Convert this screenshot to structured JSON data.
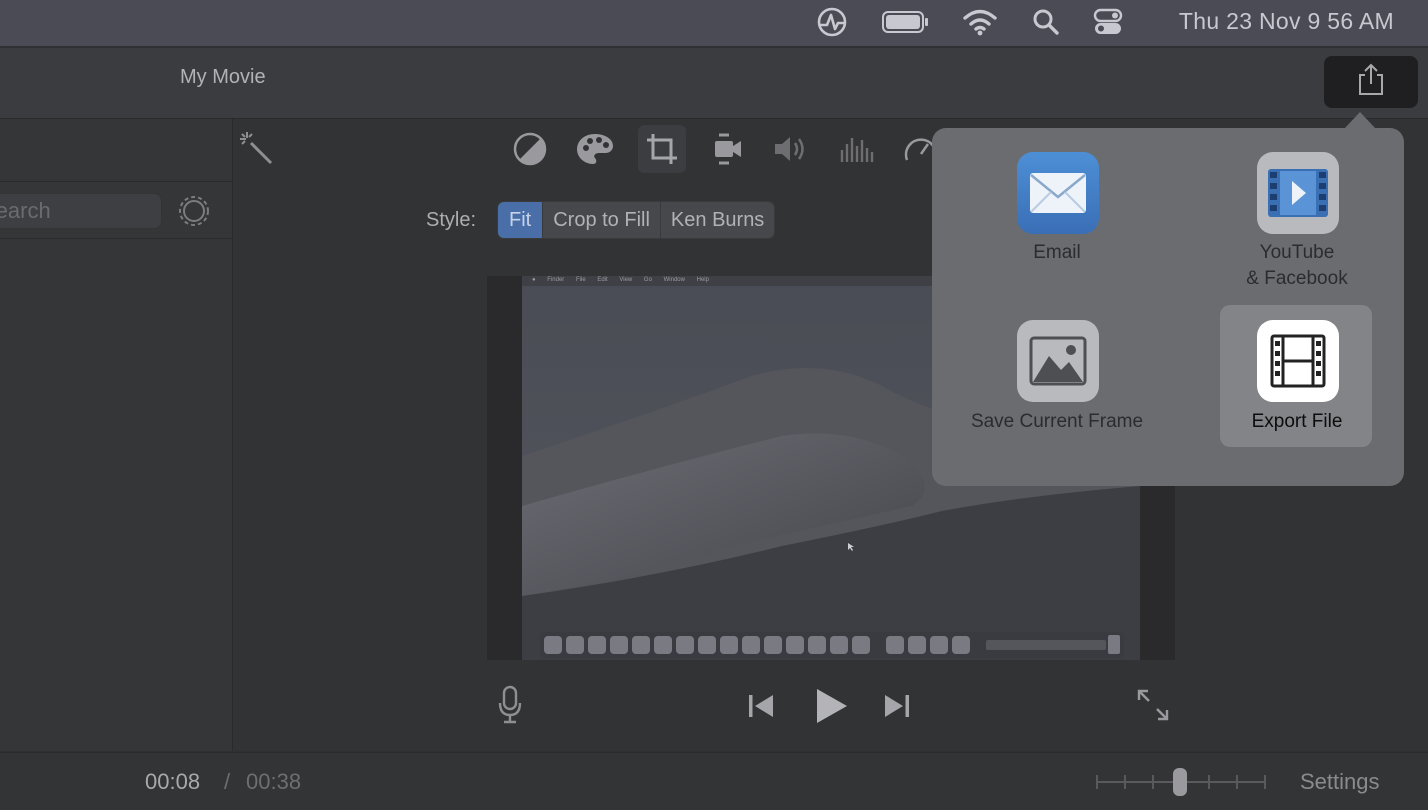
{
  "menubar": {
    "clock": "Thu 23 Nov  9 56 AM",
    "icons": [
      "activity-icon",
      "battery-icon",
      "wifi-icon",
      "search-icon",
      "control-center-icon"
    ]
  },
  "app": {
    "title": "My Movie"
  },
  "sidebar": {
    "search_placeholder": "Search"
  },
  "toolbar": {
    "tools": [
      "magic-wand-icon",
      "color-balance-icon",
      "color-correction-icon",
      "crop-icon",
      "stabilization-icon",
      "volume-icon",
      "equalizer-icon",
      "speed-icon"
    ],
    "active_tool": "crop-icon"
  },
  "style": {
    "label": "Style:",
    "options": [
      "Fit",
      "Crop to Fill",
      "Ken Burns"
    ],
    "selected": "Fit"
  },
  "preview": {
    "menu_items": [
      "Finder",
      "File",
      "Edit",
      "View",
      "Go",
      "Window",
      "Help"
    ]
  },
  "playback": {
    "current": "00:08",
    "separator": "/",
    "total": "00:38"
  },
  "bottom": {
    "settings_label": "Settings"
  },
  "share_menu": {
    "items": [
      {
        "label": "Email"
      },
      {
        "label": "YouTube\n& Facebook"
      },
      {
        "label": "Save Current Frame"
      },
      {
        "label": "Export File"
      }
    ],
    "selected": "Export File"
  },
  "colors": {
    "accent": "#4a6fa8",
    "popover_bg": "#6b6c70",
    "selected_tile": "#838488"
  }
}
